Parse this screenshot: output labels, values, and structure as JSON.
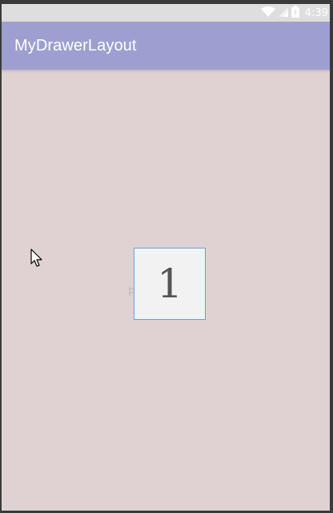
{
  "status_bar": {
    "time": "4:39",
    "icons": [
      "wifi-icon",
      "signal-icon",
      "battery-icon"
    ]
  },
  "app_bar": {
    "title": "MyDrawerLayout",
    "color": "#9e9fd1"
  },
  "content": {
    "background": "#e0d2d3",
    "box_label": "1"
  }
}
